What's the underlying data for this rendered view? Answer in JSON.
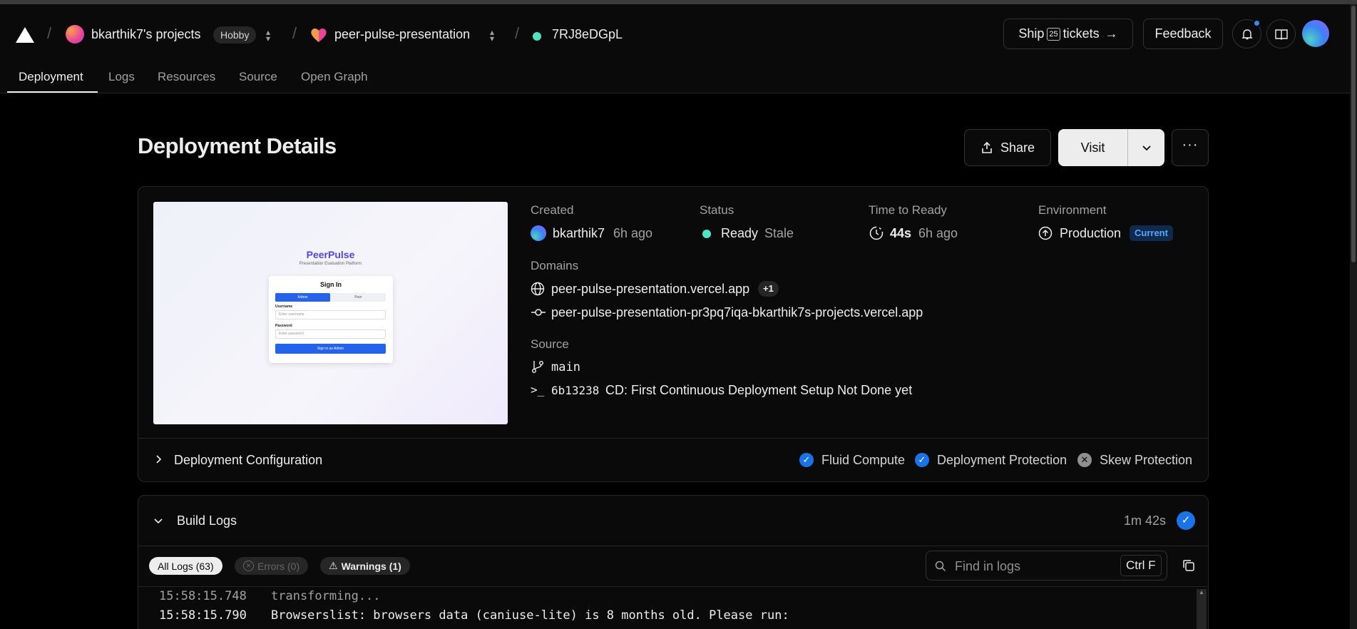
{
  "header": {
    "team_name": "bkarthik7's projects",
    "plan_badge": "Hobby",
    "project_name": "peer-pulse-presentation",
    "deployment_id": "7RJ8eDGpL",
    "ship_prefix": "Ship",
    "ship_number": "25",
    "ship_suffix": "tickets",
    "feedback_label": "Feedback",
    "icons": [
      "vercel-logo-icon",
      "notification-bell-icon",
      "docs-book-icon",
      "user-avatar"
    ]
  },
  "tabs": [
    {
      "label": "Deployment",
      "active": true
    },
    {
      "label": "Logs",
      "active": false
    },
    {
      "label": "Resources",
      "active": false
    },
    {
      "label": "Source",
      "active": false
    },
    {
      "label": "Open Graph",
      "active": false
    }
  ],
  "page": {
    "title": "Deployment Details",
    "share_label": "Share",
    "visit_label": "Visit"
  },
  "preview": {
    "app_title": "PeerPulse",
    "app_subtitle": "Presentation Evaluation Platform",
    "signin_title": "Sign In",
    "tab_admin": "Admin",
    "tab_peer": "Peer",
    "username_label": "Username",
    "username_placeholder": "Enter username",
    "password_label": "Password",
    "password_placeholder": "Enter password",
    "signin_button": "Sign in as Admin"
  },
  "details": {
    "created_label": "Created",
    "created_user": "bkarthik7",
    "created_ago": "6h ago",
    "status_label": "Status",
    "status_value": "Ready",
    "status_extra": "Stale",
    "status_color": "#50e3c2",
    "ttr_label": "Time to Ready",
    "ttr_value": "44s",
    "ttr_ago": "6h ago",
    "env_label": "Environment",
    "env_value": "Production",
    "env_badge": "Current",
    "domains_label": "Domains",
    "domain_primary": "peer-pulse-presentation.vercel.app",
    "domain_extra": "+1",
    "domain_git": "peer-pulse-presentation-pr3pq7iqa-bkarthik7s-projects.vercel.app",
    "source_label": "Source",
    "branch": "main",
    "commit_hash": "6b13238",
    "commit_message": "CD: First Continuous Deployment Setup Not Done yet"
  },
  "config": {
    "title": "Deployment Configuration",
    "fluid": "Fluid Compute",
    "protection": "Deployment Protection",
    "skew": "Skew Protection"
  },
  "build_logs": {
    "title": "Build Logs",
    "duration": "1m 42s",
    "filter_all": "All Logs (63)",
    "filter_errors": "Errors (0)",
    "filter_warnings": "Warnings (1)",
    "find_placeholder": "Find in logs",
    "find_shortcut": "Ctrl F",
    "lines": [
      {
        "time": "15:58:15.748",
        "text": "transforming..."
      },
      {
        "time": "15:58:15.790",
        "text": "Browserslist: browsers data (caniuse-lite) is 8 months old. Please run:"
      }
    ]
  }
}
